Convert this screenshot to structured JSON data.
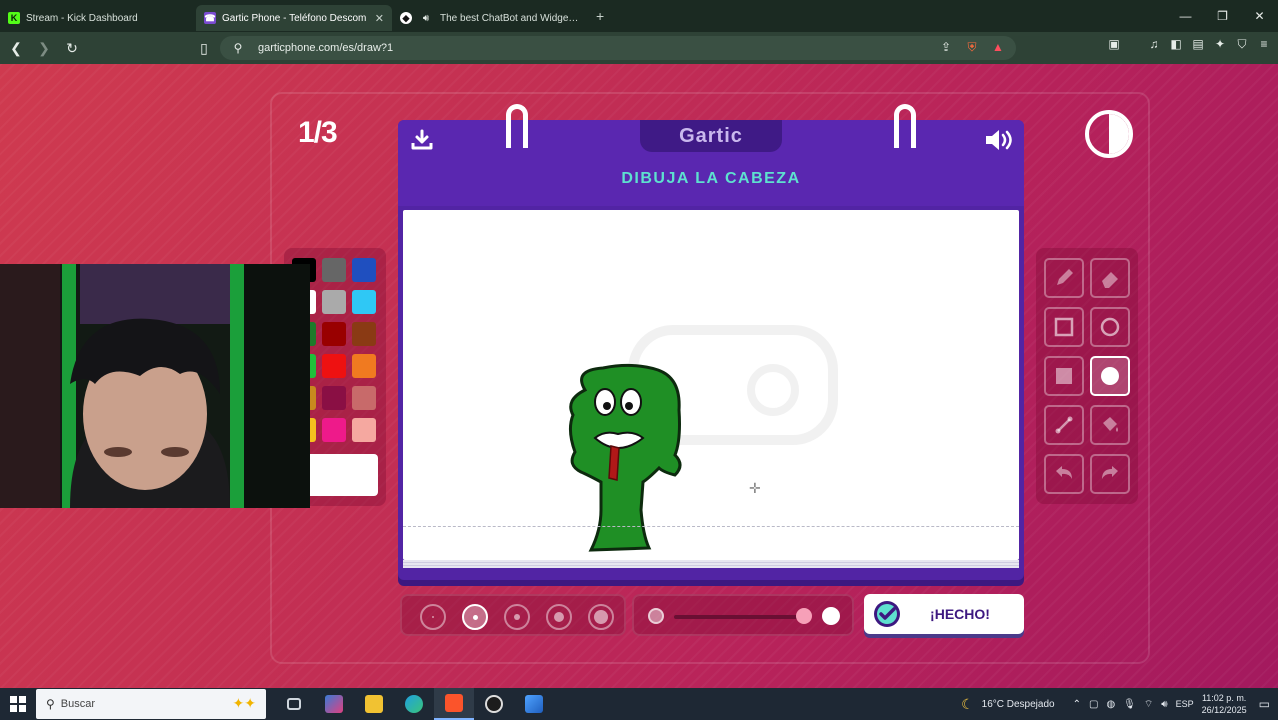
{
  "browser": {
    "tabs": [
      {
        "title": "Stream - Kick Dashboard",
        "favicon": "kick-icon",
        "active": false
      },
      {
        "title": "Gartic Phone - Teléfono Descom",
        "favicon": "gartic-phone-icon",
        "active": true
      },
      {
        "title": "The best ChatBot and Widgets fo",
        "favicon": "streamelements-icon",
        "active": false
      }
    ],
    "url": "garticphone.com/es/draw?1"
  },
  "game": {
    "round": "1/3",
    "logo": "Gartic",
    "prompt": "DIBUJA LA CABEZA",
    "done_label": "¡HECHO!",
    "palette_colors": [
      "#000000",
      "#666666",
      "#1f4fbf",
      "#ffffff",
      "#aaaaaa",
      "#2fc8f5",
      "#1d7a2a",
      "#990000",
      "#8a3a14",
      "#1fbf3a",
      "#ee1111",
      "#f07a20",
      "#c8891e",
      "#8a0f44",
      "#c86a6a",
      "#f5c21e",
      "#ee1a8a",
      "#f5a8a0"
    ],
    "selected_color": "#ffffff",
    "brush_sizes": 5,
    "selected_brush_size": 2,
    "opacity": 1.0,
    "tools": [
      "pencil-icon",
      "eraser-icon",
      "rectangle-outline-icon",
      "ellipse-outline-icon",
      "rectangle-fill-icon",
      "ellipse-fill-icon",
      "line-icon",
      "fill-bucket-icon",
      "undo-icon",
      "redo-icon"
    ],
    "selected_tool": "ellipse-fill-icon"
  },
  "taskbar": {
    "search_placeholder": "Buscar",
    "weather": "16°C  Despejado",
    "language": "ESP",
    "time": "11:02 p. m.",
    "date": "26/12/2025"
  },
  "colors": {
    "accent": "#5a27b0",
    "prompt": "#5ee0cf",
    "page_bg": "#c32f53"
  }
}
